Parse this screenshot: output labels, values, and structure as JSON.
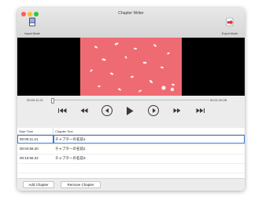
{
  "window": {
    "title": "Chapter Writer"
  },
  "toolbar": {
    "import_label": "Import Movie",
    "export_label": "Export Movie"
  },
  "player": {
    "current_time": "00:00:11.21",
    "end_time": "00:21:39.28",
    "playhead_fraction": 0.0,
    "buttons": [
      "skip-to-start",
      "step-back",
      "rewind",
      "play",
      "fast-forward",
      "step-forward",
      "skip-to-end"
    ]
  },
  "table": {
    "columns": [
      "Start Time",
      "Chapter Text"
    ],
    "rows": [
      {
        "start": "00:00:11.21",
        "text": "チャプターの名前1"
      },
      {
        "start": "00:04:58.20",
        "text": "チャプターの名前2"
      },
      {
        "start": "00:10:55.22",
        "text": "チャプターの名前3"
      }
    ]
  },
  "buttons": {
    "add": "Add Chapter",
    "remove": "Remove Chapter"
  },
  "colors": {
    "video_frame": "#ef6b73",
    "selection": "#3b7bd6"
  }
}
